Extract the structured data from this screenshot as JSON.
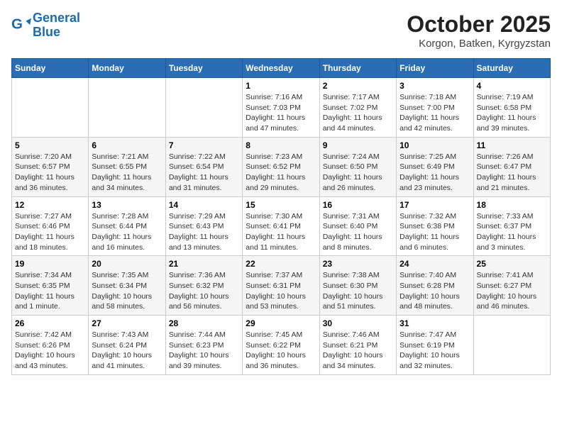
{
  "header": {
    "logo_line1": "General",
    "logo_line2": "Blue",
    "title": "October 2025",
    "subtitle": "Korgon, Batken, Kyrgyzstan"
  },
  "weekdays": [
    "Sunday",
    "Monday",
    "Tuesday",
    "Wednesday",
    "Thursday",
    "Friday",
    "Saturday"
  ],
  "weeks": [
    [
      {
        "day": "",
        "info": ""
      },
      {
        "day": "",
        "info": ""
      },
      {
        "day": "",
        "info": ""
      },
      {
        "day": "1",
        "info": "Sunrise: 7:16 AM\nSunset: 7:03 PM\nDaylight: 11 hours and 47 minutes."
      },
      {
        "day": "2",
        "info": "Sunrise: 7:17 AM\nSunset: 7:02 PM\nDaylight: 11 hours and 44 minutes."
      },
      {
        "day": "3",
        "info": "Sunrise: 7:18 AM\nSunset: 7:00 PM\nDaylight: 11 hours and 42 minutes."
      },
      {
        "day": "4",
        "info": "Sunrise: 7:19 AM\nSunset: 6:58 PM\nDaylight: 11 hours and 39 minutes."
      }
    ],
    [
      {
        "day": "5",
        "info": "Sunrise: 7:20 AM\nSunset: 6:57 PM\nDaylight: 11 hours and 36 minutes."
      },
      {
        "day": "6",
        "info": "Sunrise: 7:21 AM\nSunset: 6:55 PM\nDaylight: 11 hours and 34 minutes."
      },
      {
        "day": "7",
        "info": "Sunrise: 7:22 AM\nSunset: 6:54 PM\nDaylight: 11 hours and 31 minutes."
      },
      {
        "day": "8",
        "info": "Sunrise: 7:23 AM\nSunset: 6:52 PM\nDaylight: 11 hours and 29 minutes."
      },
      {
        "day": "9",
        "info": "Sunrise: 7:24 AM\nSunset: 6:50 PM\nDaylight: 11 hours and 26 minutes."
      },
      {
        "day": "10",
        "info": "Sunrise: 7:25 AM\nSunset: 6:49 PM\nDaylight: 11 hours and 23 minutes."
      },
      {
        "day": "11",
        "info": "Sunrise: 7:26 AM\nSunset: 6:47 PM\nDaylight: 11 hours and 21 minutes."
      }
    ],
    [
      {
        "day": "12",
        "info": "Sunrise: 7:27 AM\nSunset: 6:46 PM\nDaylight: 11 hours and 18 minutes."
      },
      {
        "day": "13",
        "info": "Sunrise: 7:28 AM\nSunset: 6:44 PM\nDaylight: 11 hours and 16 minutes."
      },
      {
        "day": "14",
        "info": "Sunrise: 7:29 AM\nSunset: 6:43 PM\nDaylight: 11 hours and 13 minutes."
      },
      {
        "day": "15",
        "info": "Sunrise: 7:30 AM\nSunset: 6:41 PM\nDaylight: 11 hours and 11 minutes."
      },
      {
        "day": "16",
        "info": "Sunrise: 7:31 AM\nSunset: 6:40 PM\nDaylight: 11 hours and 8 minutes."
      },
      {
        "day": "17",
        "info": "Sunrise: 7:32 AM\nSunset: 6:38 PM\nDaylight: 11 hours and 6 minutes."
      },
      {
        "day": "18",
        "info": "Sunrise: 7:33 AM\nSunset: 6:37 PM\nDaylight: 11 hours and 3 minutes."
      }
    ],
    [
      {
        "day": "19",
        "info": "Sunrise: 7:34 AM\nSunset: 6:35 PM\nDaylight: 11 hours and 1 minute."
      },
      {
        "day": "20",
        "info": "Sunrise: 7:35 AM\nSunset: 6:34 PM\nDaylight: 10 hours and 58 minutes."
      },
      {
        "day": "21",
        "info": "Sunrise: 7:36 AM\nSunset: 6:32 PM\nDaylight: 10 hours and 56 minutes."
      },
      {
        "day": "22",
        "info": "Sunrise: 7:37 AM\nSunset: 6:31 PM\nDaylight: 10 hours and 53 minutes."
      },
      {
        "day": "23",
        "info": "Sunrise: 7:38 AM\nSunset: 6:30 PM\nDaylight: 10 hours and 51 minutes."
      },
      {
        "day": "24",
        "info": "Sunrise: 7:40 AM\nSunset: 6:28 PM\nDaylight: 10 hours and 48 minutes."
      },
      {
        "day": "25",
        "info": "Sunrise: 7:41 AM\nSunset: 6:27 PM\nDaylight: 10 hours and 46 minutes."
      }
    ],
    [
      {
        "day": "26",
        "info": "Sunrise: 7:42 AM\nSunset: 6:26 PM\nDaylight: 10 hours and 43 minutes."
      },
      {
        "day": "27",
        "info": "Sunrise: 7:43 AM\nSunset: 6:24 PM\nDaylight: 10 hours and 41 minutes."
      },
      {
        "day": "28",
        "info": "Sunrise: 7:44 AM\nSunset: 6:23 PM\nDaylight: 10 hours and 39 minutes."
      },
      {
        "day": "29",
        "info": "Sunrise: 7:45 AM\nSunset: 6:22 PM\nDaylight: 10 hours and 36 minutes."
      },
      {
        "day": "30",
        "info": "Sunrise: 7:46 AM\nSunset: 6:21 PM\nDaylight: 10 hours and 34 minutes."
      },
      {
        "day": "31",
        "info": "Sunrise: 7:47 AM\nSunset: 6:19 PM\nDaylight: 10 hours and 32 minutes."
      },
      {
        "day": "",
        "info": ""
      }
    ]
  ]
}
